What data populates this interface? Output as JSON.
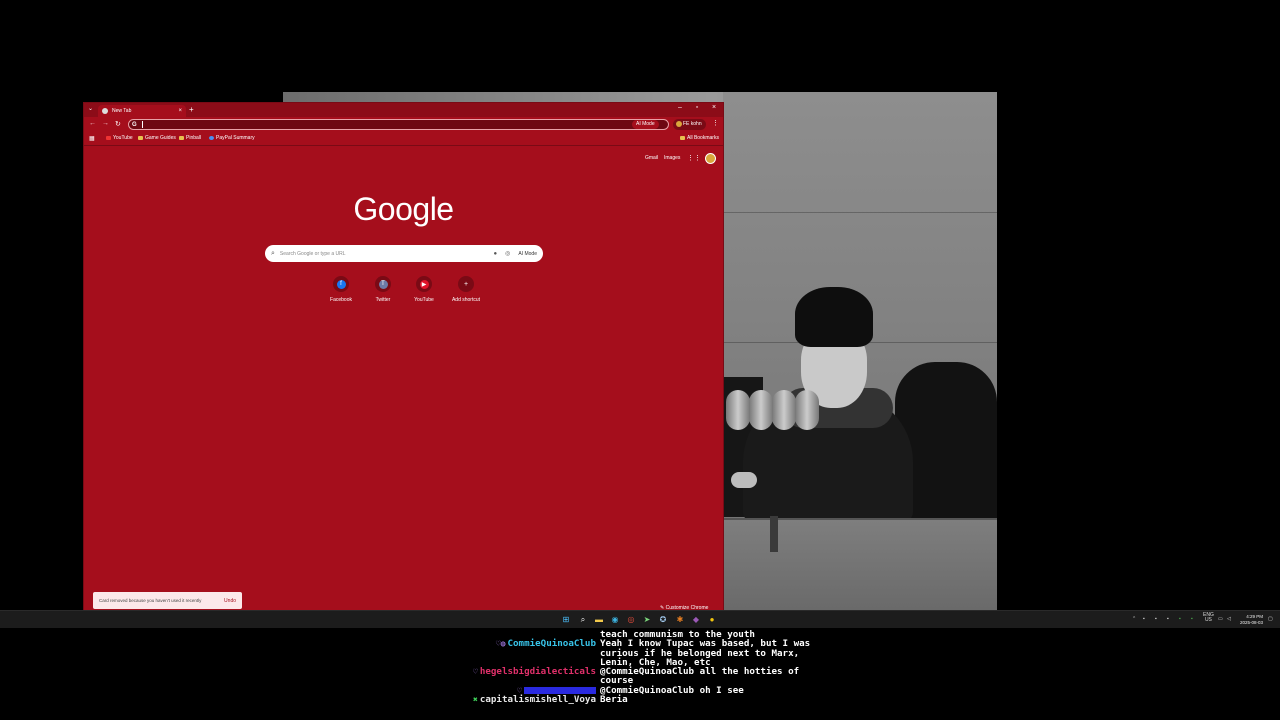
{
  "browser": {
    "tab_title": "New Tab",
    "omnibox_icon": "G",
    "ai_mode_top": "AI Mode",
    "profile_label": "FE kohn",
    "bookmarks": [
      {
        "label": "YouTube",
        "icon": "youtube-icon"
      },
      {
        "label": "Game Guides",
        "icon": "folder-icon"
      },
      {
        "label": "Pinball",
        "icon": "folder-icon"
      },
      {
        "label": "PayPal Summary",
        "icon": "paypal-icon"
      }
    ],
    "all_bookmarks": "All Bookmarks",
    "gmail": "Gmail",
    "images": "Images",
    "logo": "Google",
    "search_placeholder": "Search Google or type a URL",
    "search_ai_mode": "AI Mode",
    "shortcuts": [
      {
        "label": "Facebook",
        "glyph": "f",
        "color": "#1877f2"
      },
      {
        "label": "Twitter",
        "glyph": "T",
        "color": "#6d7aa8"
      },
      {
        "label": "YouTube",
        "glyph": "▶",
        "color": "#e0142a"
      },
      {
        "label": "Add shortcut",
        "glyph": "+",
        "color": "#7a0a15"
      }
    ],
    "toast_message": "Card removed because you haven't used it recently",
    "toast_undo": "Undo",
    "customize": "Customize Chrome",
    "theme_color": "#a50e1c"
  },
  "taskbar": {
    "lang_top": "ENG",
    "lang_bottom": "US",
    "time": "4:29 PM",
    "date": "2025-08-03"
  },
  "chat": [
    {
      "user": "",
      "message": "teach communism to the youth",
      "color": "#ffffff",
      "badge": ""
    },
    {
      "user": "CommieQuinoaClub",
      "message": "Yeah I know Tupac was based, but I was curious if he belonged next to Marx, Lenin, Che, Mao, etc",
      "color": "#38c3e8",
      "badge": "♡◍"
    },
    {
      "user": "hegelsbigdialecticals",
      "message": "@CommieQuinoaClub all the hotties of course",
      "color": "#e0306a",
      "badge": "♡"
    },
    {
      "user": "",
      "message": "@CommieQuinoaClub oh I see",
      "color": "#2a2ae0",
      "badge": "♡"
    },
    {
      "user": "capitalismishell_Voya",
      "message": "Beria",
      "color": "#e8e8e8",
      "badge": "✖"
    }
  ]
}
